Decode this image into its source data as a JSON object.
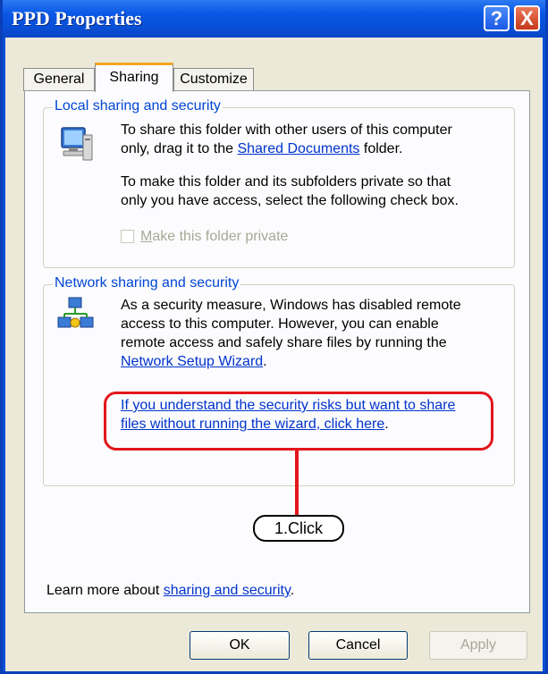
{
  "window": {
    "title": "PPD Properties",
    "help_glyph": "?",
    "close_glyph": "X"
  },
  "tabs": [
    "General",
    "Sharing",
    "Customize"
  ],
  "local": {
    "title": "Local sharing and security",
    "text1_pre": "To share this folder with other users of this computer",
    "text1_line2_pre": "only, drag it to the ",
    "shared_docs_link": "Shared Documents",
    "text1_line2_post": " folder.",
    "text2_line1": "To make this folder and its subfolders private so that",
    "text2_line2": "only you have access, select the following check box.",
    "checkbox_label": "Make this folder private",
    "checkbox_checked": false
  },
  "network": {
    "title": "Network sharing and security",
    "line1": "As a security measure, Windows has disabled remote",
    "line2": "access to this computer. However, you can enable",
    "line3": "remote access and safely share files by running the",
    "wizard_link": "Network Setup Wizard",
    "wizard_link_suffix": ".",
    "risk_link_line1": "If you understand the security risks but want to share",
    "risk_link_line2": "files without running the wizard, click here",
    "risk_link_suffix": "."
  },
  "annotation": {
    "step_label": "1.Click",
    "color": "#e2161b"
  },
  "learn_more": {
    "prefix": "Learn more about ",
    "link": "sharing and security",
    "suffix": "."
  },
  "buttons": {
    "ok": "OK",
    "cancel": "Cancel",
    "apply": "Apply"
  }
}
